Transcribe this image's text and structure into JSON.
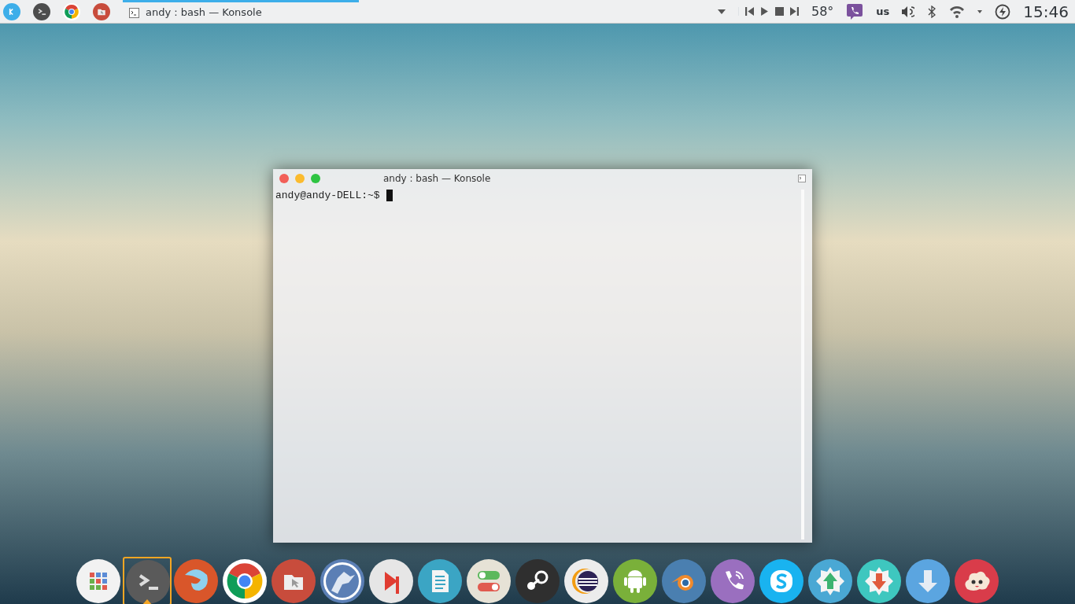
{
  "panel": {
    "launchers": [
      {
        "kind": "kde"
      },
      {
        "kind": "terminal"
      },
      {
        "kind": "chrome"
      },
      {
        "kind": "files"
      }
    ],
    "tasks": [
      {
        "title": "andy : bash — Konsole",
        "selected": true
      }
    ],
    "tray": {
      "temperature": "58°",
      "keyboard_layout": "us",
      "clock": "15:46"
    }
  },
  "window": {
    "title": "andy : bash — Konsole",
    "prompt": "andy@andy-DELL:~$"
  },
  "dock": [
    {
      "kind": "apps",
      "color": "#f2f2f2",
      "selected": false
    },
    {
      "kind": "terminal",
      "color": "#5a5a5a",
      "selected": true
    },
    {
      "kind": "firefox",
      "color": "#d9562a",
      "selected": false
    },
    {
      "kind": "chrome",
      "color": "#ffffff",
      "selected": false
    },
    {
      "kind": "files",
      "color": "#c84c3c",
      "selected": false
    },
    {
      "kind": "wolf",
      "color": "#5b7fb5",
      "selected": false
    },
    {
      "kind": "player",
      "color": "#e6e6e6",
      "selected": false
    },
    {
      "kind": "document",
      "color": "#3ba5c4",
      "selected": false
    },
    {
      "kind": "toggles",
      "color": "#e6e2d6",
      "selected": false
    },
    {
      "kind": "steam",
      "color": "#2f2f2f",
      "selected": false
    },
    {
      "kind": "eclipse",
      "color": "#ececec",
      "selected": false
    },
    {
      "kind": "android",
      "color": "#7ab03a",
      "selected": false
    },
    {
      "kind": "blender",
      "color": "#4a7fb0",
      "selected": false
    },
    {
      "kind": "viber",
      "color": "#9a6fbf",
      "selected": false
    },
    {
      "kind": "skype",
      "color": "#19b3f0",
      "selected": false
    },
    {
      "kind": "upload",
      "color": "#4aa8d4",
      "selected": false
    },
    {
      "kind": "download-badge",
      "color": "#3ec7bf",
      "selected": false
    },
    {
      "kind": "download",
      "color": "#5ba5e0",
      "selected": false
    },
    {
      "kind": "cloud",
      "color": "#d93c4a",
      "selected": false
    }
  ]
}
